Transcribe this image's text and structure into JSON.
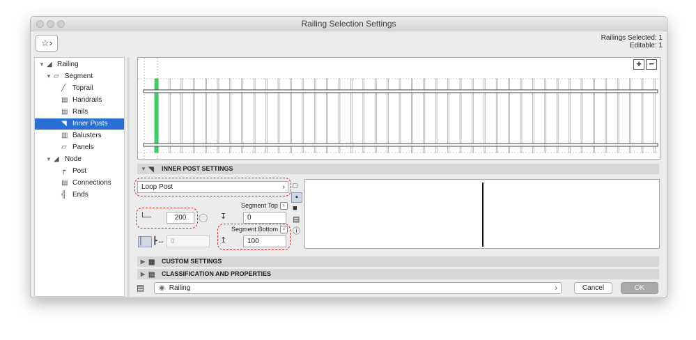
{
  "window": {
    "title": "Railing Selection Settings",
    "selection_line1": "Railings Selected: 1",
    "selection_line2": "Editable: 1",
    "favorites_glyph": "☆›"
  },
  "tree": {
    "items": [
      {
        "label": "Railing",
        "icon": "railing-icon",
        "level": 0,
        "expanded": true
      },
      {
        "label": "Segment",
        "icon": "segment-icon",
        "level": 1,
        "expanded": true
      },
      {
        "label": "Toprail",
        "icon": "toprail-icon",
        "level": 2
      },
      {
        "label": "Handrails",
        "icon": "handrails-icon",
        "level": 2
      },
      {
        "label": "Rails",
        "icon": "rails-icon",
        "level": 2
      },
      {
        "label": "Inner Posts",
        "icon": "inner-posts-icon",
        "level": 2,
        "selected": true
      },
      {
        "label": "Balusters",
        "icon": "balusters-icon",
        "level": 2
      },
      {
        "label": "Panels",
        "icon": "panels-icon",
        "level": 2
      },
      {
        "label": "Node",
        "icon": "node-icon",
        "level": 1,
        "expanded": true
      },
      {
        "label": "Post",
        "icon": "post-icon",
        "level": 2
      },
      {
        "label": "Connections",
        "icon": "connections-icon",
        "level": 2
      },
      {
        "label": "Ends",
        "icon": "ends-icon",
        "level": 2
      }
    ]
  },
  "preview": {
    "zoom_in": "+",
    "zoom_out": "−",
    "accent_color": "#3fd46a"
  },
  "inner_posts": {
    "header": "INNER POST SETTINGS",
    "post_type": "Loop Post",
    "post_type_chevron": "›",
    "spacing_value": "200",
    "distance_value": "0",
    "segment_top_label": "Segment Top",
    "segment_top_value": "0",
    "segment_bottom_label": "Segment Bottom",
    "segment_bottom_value": "100",
    "chevron": "›"
  },
  "sections": {
    "custom_settings": "CUSTOM SETTINGS",
    "classification": "CLASSIFICATION AND PROPERTIES"
  },
  "footer": {
    "layer_value": "Railing",
    "layer_chevron": "›",
    "cancel_label": "Cancel",
    "ok_label": "OK"
  },
  "colors": {
    "selection": "#2a6fd6",
    "highlight_dashes": "#d0281c"
  }
}
